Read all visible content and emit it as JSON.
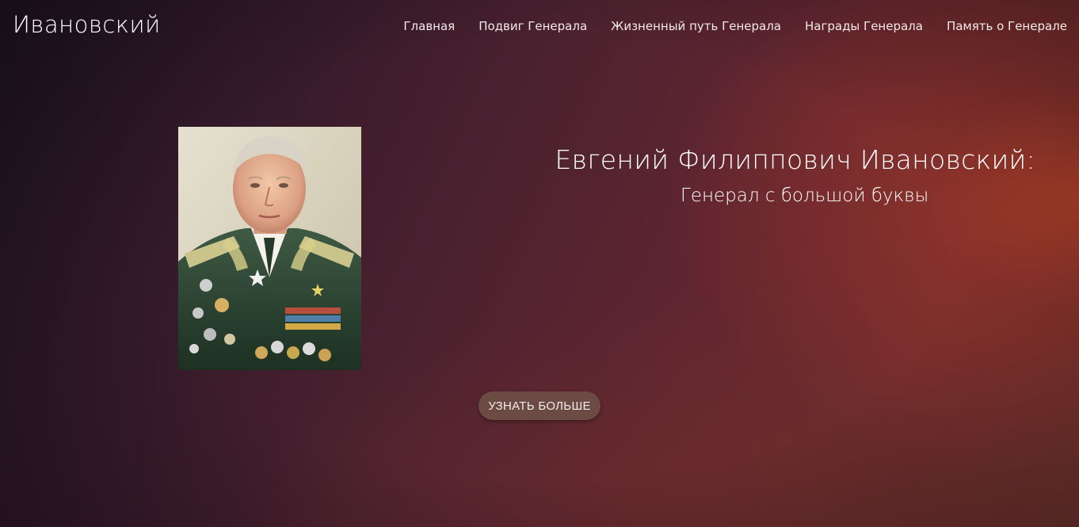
{
  "navbar": {
    "brand": "Ивановский",
    "links": [
      {
        "label": "Главная"
      },
      {
        "label": "Подвиг Генерала"
      },
      {
        "label": "Жизненный путь Генерала"
      },
      {
        "label": "Награды Генерала"
      },
      {
        "label": "Память о Генерале"
      }
    ]
  },
  "hero": {
    "title": "Евгений Филиппович Ивановский:",
    "subtitle": "Генерал с большой буквы",
    "button_label": "УЗНАТЬ БОЛЬШЕ",
    "portrait_alt": "portrait of a general in uniform with medals"
  },
  "colors": {
    "text": "#ffffff",
    "button_bg": "#6c4b44",
    "accent_glow": "#b24028",
    "background_dark": "#1d1220"
  }
}
